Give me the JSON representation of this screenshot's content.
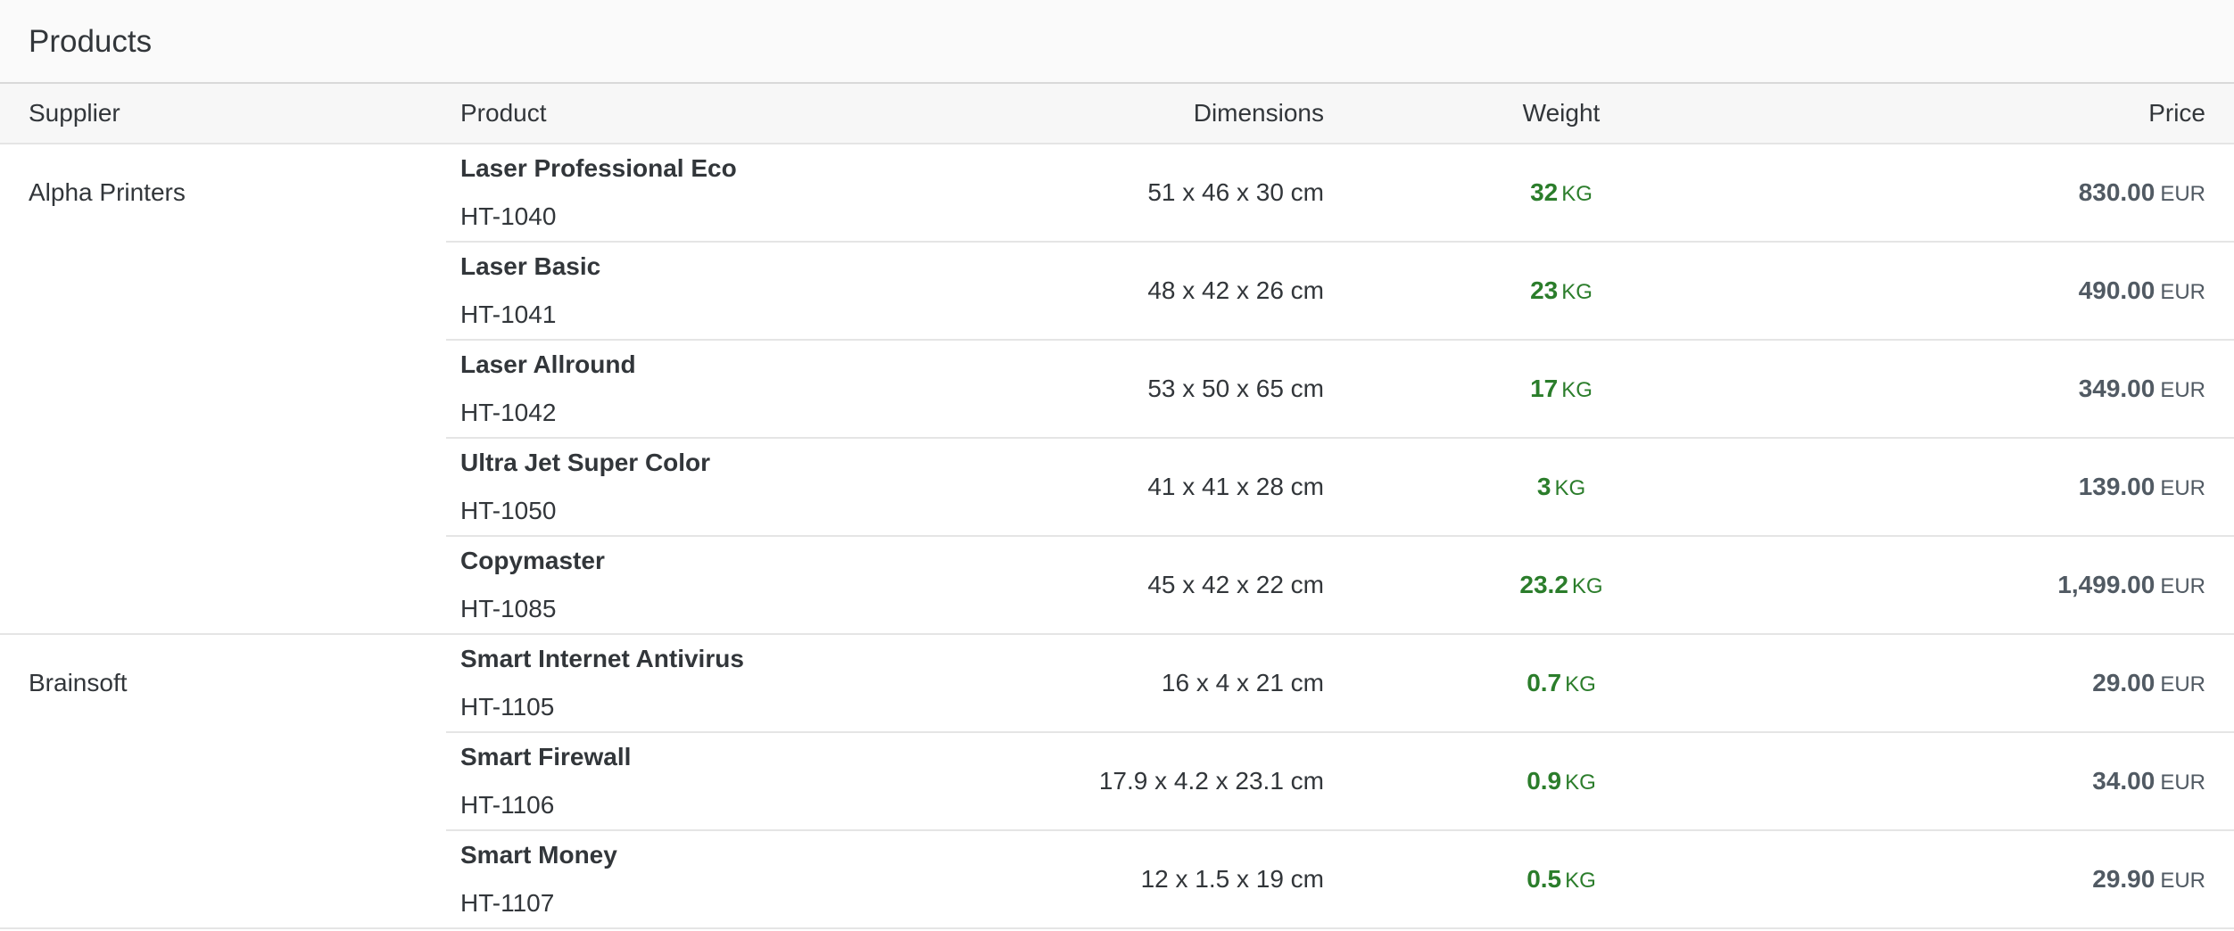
{
  "toolbar": {
    "title": "Products"
  },
  "columns": {
    "supplier": "Supplier",
    "product": "Product",
    "dimensions": "Dimensions",
    "weight": "Weight",
    "price": "Price"
  },
  "groups": [
    {
      "supplier": "Alpha Printers",
      "rows": [
        {
          "name": "Laser Professional Eco",
          "id": "HT-1040",
          "dimensions": "51 x 46 x 30 cm",
          "weight": "32",
          "weight_unit": "KG",
          "price": "830.00",
          "currency": "EUR"
        },
        {
          "name": "Laser Basic",
          "id": "HT-1041",
          "dimensions": "48 x 42 x 26 cm",
          "weight": "23",
          "weight_unit": "KG",
          "price": "490.00",
          "currency": "EUR"
        },
        {
          "name": "Laser Allround",
          "id": "HT-1042",
          "dimensions": "53 x 50 x 65 cm",
          "weight": "17",
          "weight_unit": "KG",
          "price": "349.00",
          "currency": "EUR"
        },
        {
          "name": "Ultra Jet Super Color",
          "id": "HT-1050",
          "dimensions": "41 x 41 x 28 cm",
          "weight": "3",
          "weight_unit": "KG",
          "price": "139.00",
          "currency": "EUR"
        },
        {
          "name": "Copymaster",
          "id": "HT-1085",
          "dimensions": "45 x 42 x 22 cm",
          "weight": "23.2",
          "weight_unit": "KG",
          "price": "1,499.00",
          "currency": "EUR"
        }
      ]
    },
    {
      "supplier": "Brainsoft",
      "rows": [
        {
          "name": "Smart Internet Antivirus",
          "id": "HT-1105",
          "dimensions": "16 x 4 x 21 cm",
          "weight": "0.7",
          "weight_unit": "KG",
          "price": "29.00",
          "currency": "EUR"
        },
        {
          "name": "Smart Firewall",
          "id": "HT-1106",
          "dimensions": "17.9 x 4.2 x 23.1 cm",
          "weight": "0.9",
          "weight_unit": "KG",
          "price": "34.00",
          "currency": "EUR"
        },
        {
          "name": "Smart Money",
          "id": "HT-1107",
          "dimensions": "12 x 1.5 x 19 cm",
          "weight": "0.5",
          "weight_unit": "KG",
          "price": "29.90",
          "currency": "EUR"
        }
      ]
    }
  ],
  "colors": {
    "weight": "#2b7d2b",
    "price": "#515a63",
    "text": "#32363a"
  }
}
